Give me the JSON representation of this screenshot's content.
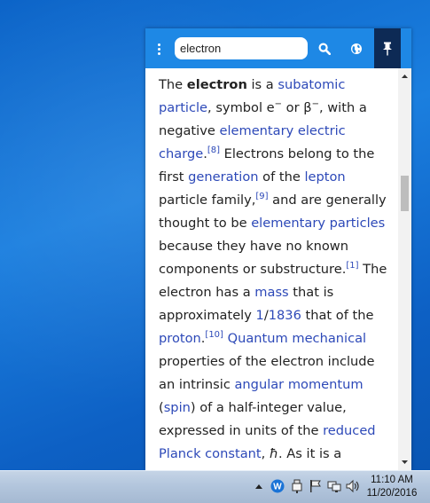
{
  "search": {
    "value": "electron"
  },
  "article": {
    "html": "The <b>electron</b> is a <a>subatomic particle</a>, symbol e<sup>−</sup> or β<sup>−</sup>, with a negative <a>elementary electric charge</a>.<sup><a>[8]</a></sup> Electrons belong to the first <a>generation</a> of the <a>lepton</a> particle family,<sup><a>[9]</a></sup> and are generally thought to be <a>elementary particles</a> because they have no known components or substructure.<sup><a>[1]</a></sup> The electron has a <a>mass</a> that is approximately <a>1</a>/<a>1836</a> that of the <a>proton</a>.<sup><a>[10]</a></sup> <a>Quantum mechanical</a> properties of the electron include an intrinsic <a>angular momentum</a> (<a>spin</a>) of a half-integer value, expressed in units of the <a>reduced Planck constant</a>, <i>ħ</i>. As it is a"
  },
  "taskbar": {
    "time": "11:10 AM",
    "date": "11/20/2016"
  },
  "icons": {
    "menu": "vertical-dots-icon",
    "search": "magnifier-icon",
    "globe": "globe-icon",
    "pin": "pin-icon"
  },
  "colors": {
    "header": "#1e88e5",
    "pin_active": "#0d2a55",
    "link": "#2d49b8"
  }
}
